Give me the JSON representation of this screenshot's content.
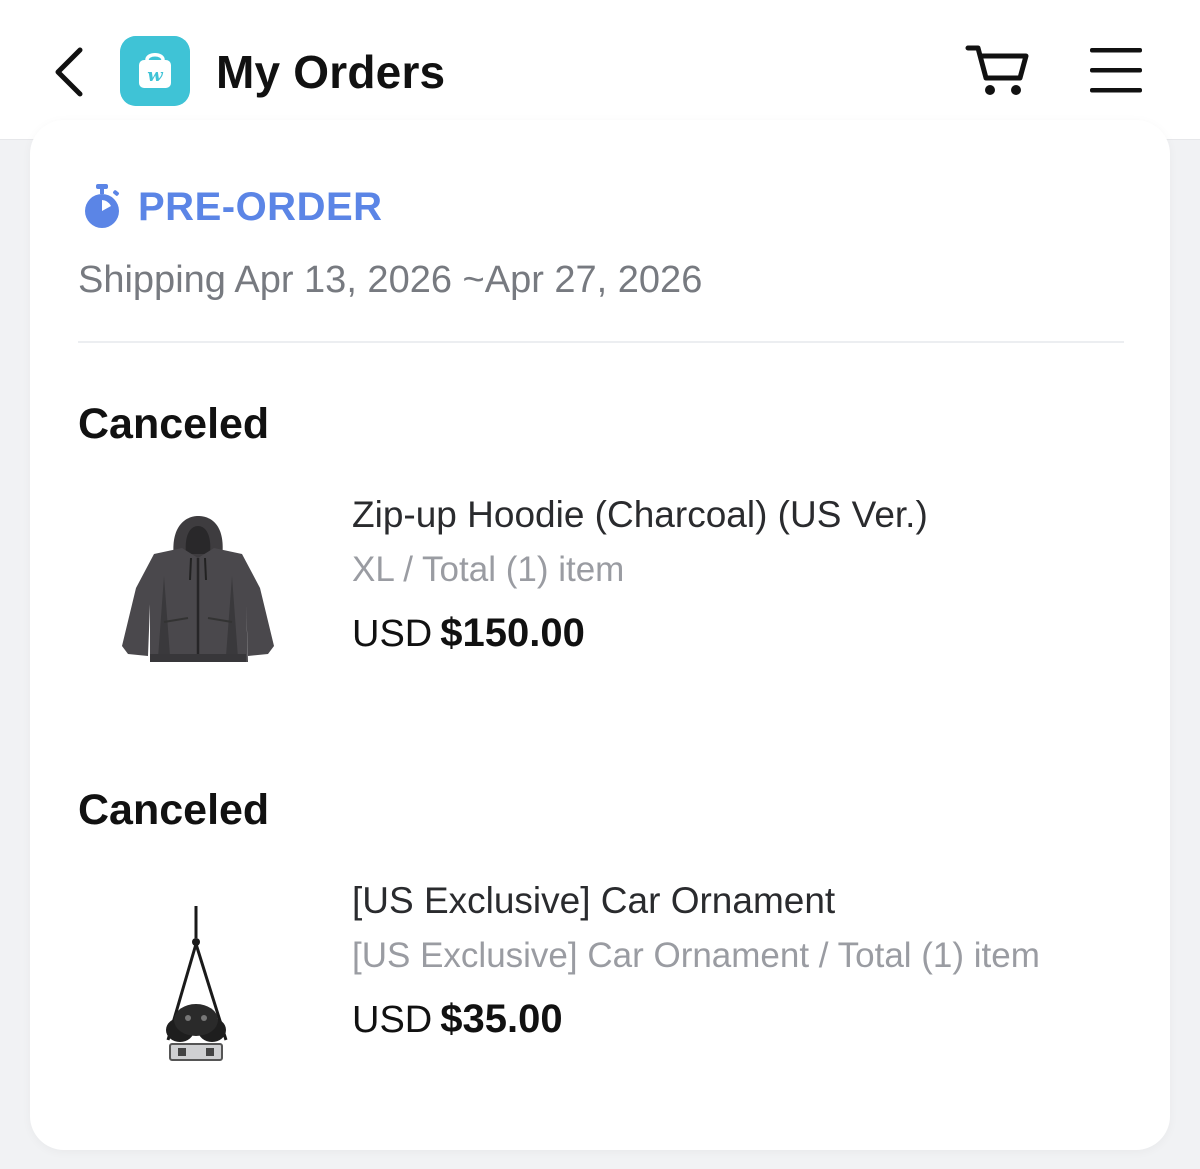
{
  "header": {
    "title": "My Orders",
    "logo_letter": "w"
  },
  "preorder": {
    "label": "PRE-ORDER",
    "shipping": "Shipping Apr 13, 2026 ~Apr 27, 2026"
  },
  "orders": [
    {
      "status": "Canceled",
      "name": "Zip-up Hoodie (Charcoal) (US Ver.)",
      "option": "XL / Total (1) item",
      "currency": "USD",
      "price": "$150.00",
      "image_icon": "hoodie-image"
    },
    {
      "status": "Canceled",
      "name": "[US Exclusive] Car Ornament",
      "option": "[US Exclusive] Car Ornament / Total (1) item",
      "currency": "USD",
      "price": "$35.00",
      "image_icon": "car-ornament-image"
    }
  ],
  "icons": {
    "back": "chevron-left-icon",
    "cart": "cart-icon",
    "menu": "hamburger-menu-icon",
    "preorder": "stopwatch-icon"
  },
  "colors": {
    "accent": "#5b85e6",
    "logo": "#3fc3d6",
    "muted_text": "#777a80",
    "option_text": "#9a9ca2",
    "background": "#f1f2f4"
  }
}
